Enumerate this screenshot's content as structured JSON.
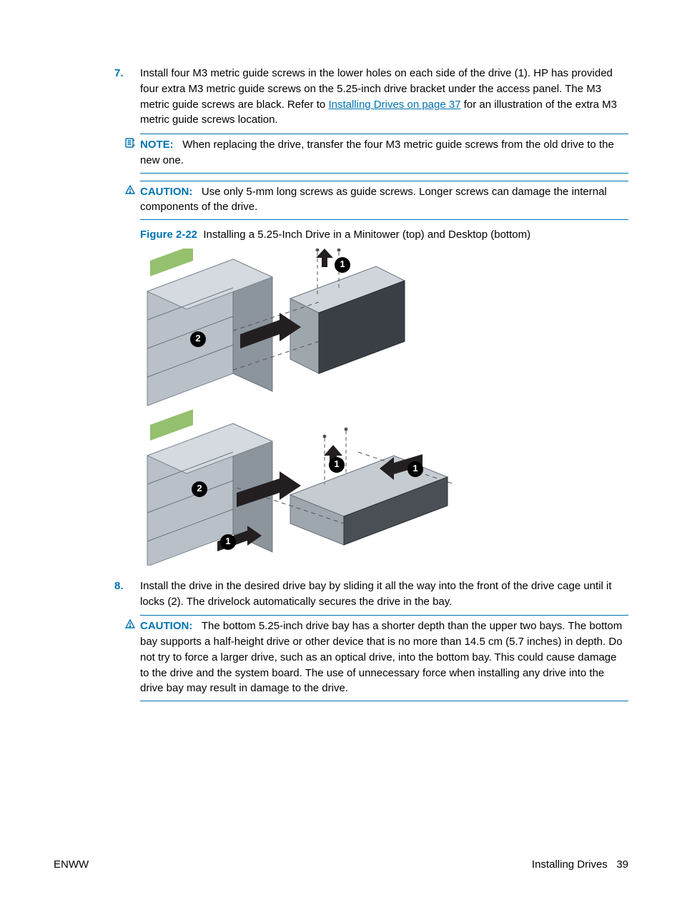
{
  "steps": {
    "s7": {
      "num": "7.",
      "text_before_link": "Install four M3 metric guide screws in the lower holes on each side of the drive (1). HP has provided four extra M3 metric guide screws on the 5.25-inch drive bracket under the access panel. The M3 metric guide screws are black. Refer to ",
      "link_text": "Installing Drives on page 37",
      "text_after_link": " for an illustration of the extra M3 metric guide screws location."
    },
    "s8": {
      "num": "8.",
      "text": "Install the drive in the desired drive bay by sliding it all the way into the front of the drive cage until it locks (2). The drivelock automatically secures the drive in the bay."
    }
  },
  "admon": {
    "note1": {
      "label": "NOTE:",
      "text": "When replacing the drive, transfer the four M3 metric guide screws from the old drive to the new one."
    },
    "caution1": {
      "label": "CAUTION:",
      "text": "Use only 5-mm long screws as guide screws. Longer screws can damage the internal components of the drive."
    },
    "caution2": {
      "label": "CAUTION:",
      "text": "The bottom 5.25-inch drive bay has a shorter depth than the upper two bays. The bottom bay supports a half-height drive or other device that is no more than 14.5 cm (5.7 inches) in depth. Do not try to force a larger drive, such as an optical drive, into the bottom bay. This could cause damage to the drive and the system board. The use of unnecessary force when installing any drive into the drive bay may result in damage to the drive."
    }
  },
  "figure": {
    "label": "Figure 2-22",
    "caption": "Installing a 5.25-Inch Drive in a Minitower (top) and Desktop (bottom)",
    "callouts": {
      "c1": "1",
      "c2": "2",
      "c3": "1",
      "c4": "1",
      "c5": "2",
      "c6": "1"
    }
  },
  "footer": {
    "left": "ENWW",
    "right_text": "Installing Drives",
    "page_num": "39"
  }
}
